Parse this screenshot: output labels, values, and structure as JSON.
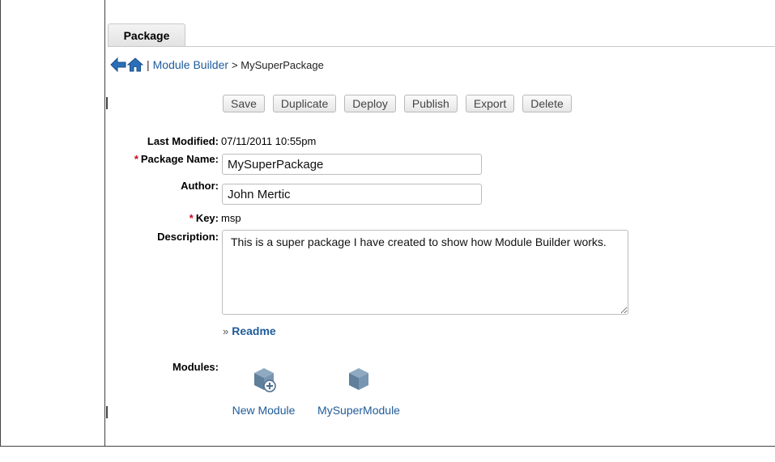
{
  "tabs": [
    {
      "label": "Package"
    }
  ],
  "breadcrumb": {
    "back_icon": "back-arrow-icon",
    "home_icon": "home-icon",
    "separator": "|",
    "link": "Module Builder",
    "current": "> MySuperPackage"
  },
  "toolbar": {
    "save": "Save",
    "duplicate": "Duplicate",
    "deploy": "Deploy",
    "publish": "Publish",
    "export": "Export",
    "delete": "Delete"
  },
  "form": {
    "required_marker": "*",
    "last_modified_label": "Last Modified:",
    "last_modified_value": "07/11/2011 10:55pm",
    "package_name_label": "Package Name:",
    "package_name_value": "MySuperPackage",
    "author_label": "Author:",
    "author_value": "John Mertic",
    "key_label": "Key:",
    "key_value": "msp",
    "description_label": "Description:",
    "description_value": "This is a super package I have created to show how Module Builder works.",
    "readme_label": "Readme",
    "modules_label": "Modules:"
  },
  "modules": [
    {
      "label": "New Module",
      "icon": "cube-add-icon"
    },
    {
      "label": "MySuperModule",
      "icon": "cube-icon"
    }
  ],
  "colors": {
    "link": "#1f5b9a",
    "required": "#d0021b",
    "cube": "#6e8ea8"
  }
}
